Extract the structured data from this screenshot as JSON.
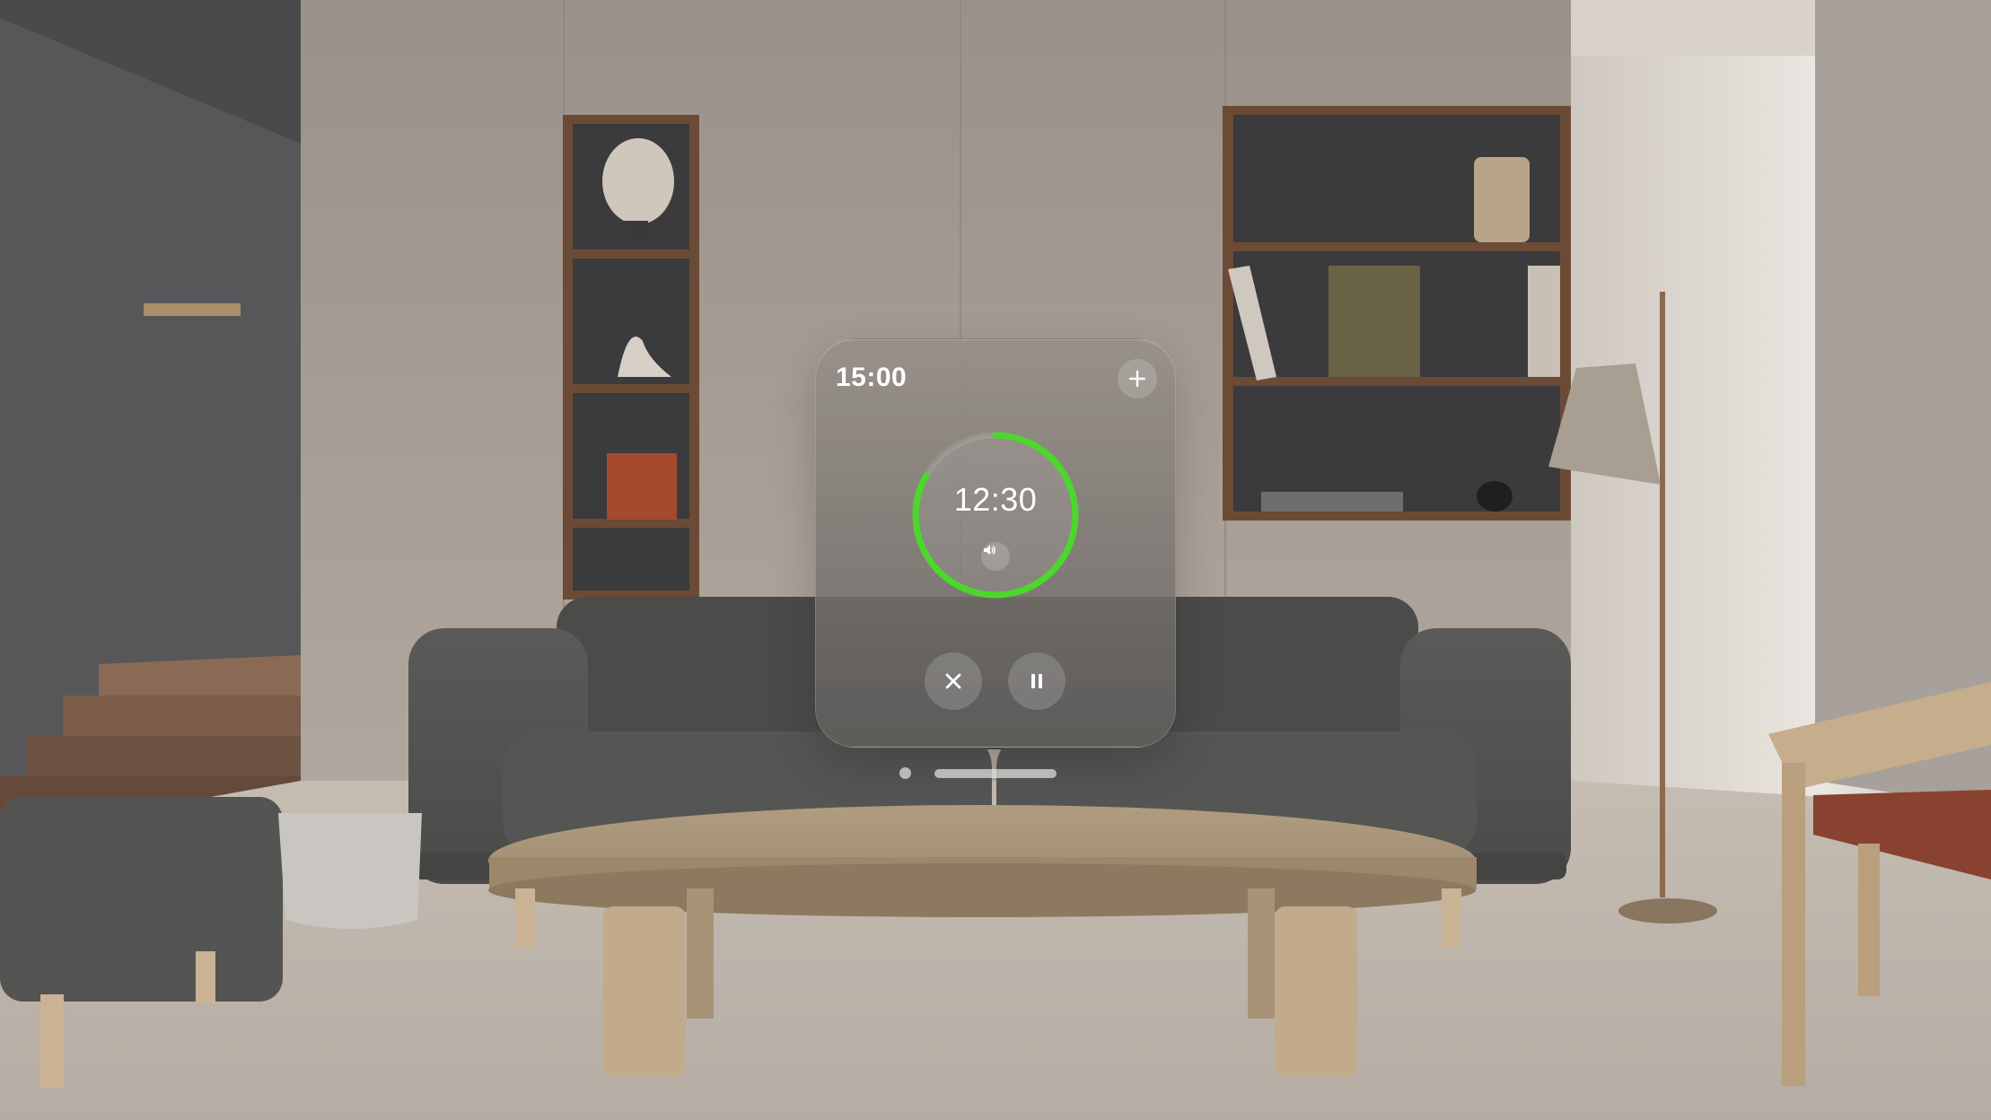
{
  "timer": {
    "duration": "15:00",
    "remaining": "12:30",
    "progress_remaining": 0.833,
    "ring_color": "#4ad92a",
    "icons": {
      "add": "plus-icon",
      "sound": "speaker-icon",
      "cancel": "close-icon",
      "pause": "pause-icon"
    }
  }
}
